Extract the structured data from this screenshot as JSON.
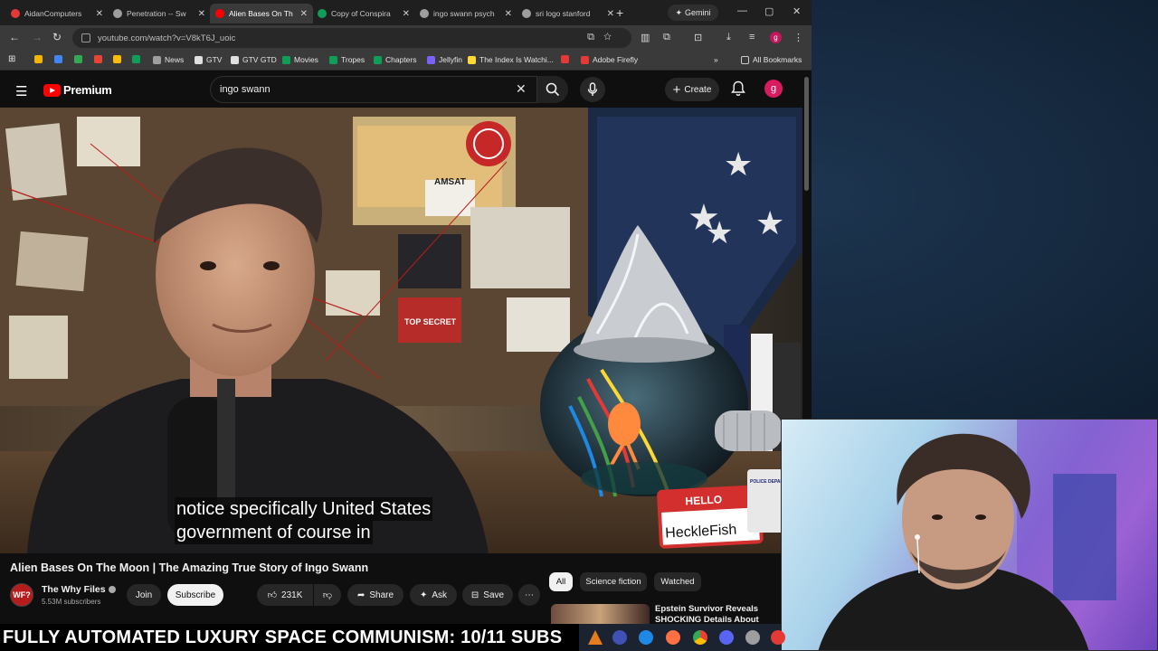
{
  "browser": {
    "tabs": [
      {
        "title": "AidanComputers",
        "favicon_color": "#e53935",
        "active": false
      },
      {
        "title": "Penetration -- Sw",
        "favicon_color": "#9e9e9e",
        "active": false
      },
      {
        "title": "Alien Bases On Th",
        "favicon_color": "#ff0000",
        "active": true
      },
      {
        "title": "Copy of Conspira",
        "favicon_color": "#0f9d58",
        "active": false
      },
      {
        "title": "ingo swann psych",
        "favicon_color": "#9e9e9e",
        "active": false
      },
      {
        "title": "sri logo stanford",
        "favicon_color": "#9e9e9e",
        "active": false
      }
    ],
    "new_tab_label": "+",
    "gemini_label": "Gemini",
    "url": "youtube.com/watch?v=V8kT6J_uoic",
    "profile_initial": "g",
    "bookmarks": [
      {
        "label": "",
        "color": "#f4b400"
      },
      {
        "label": "",
        "color": "#4285f4"
      },
      {
        "label": "",
        "color": "#34a853"
      },
      {
        "label": "",
        "color": "#ea4335"
      },
      {
        "label": "",
        "color": "#fbbc05"
      },
      {
        "label": "",
        "color": "#0f9d58"
      },
      {
        "label": "News",
        "color": "#9e9e9e"
      },
      {
        "label": "GTV",
        "color": "#e0e0e0"
      },
      {
        "label": "GTV GTD",
        "color": "#e0e0e0"
      },
      {
        "label": "Movies",
        "color": "#0f9d58"
      },
      {
        "label": "Tropes",
        "color": "#0f9d58"
      },
      {
        "label": "Chapters",
        "color": "#0f9d58"
      },
      {
        "label": "Jellyfin",
        "color": "#7b61ff"
      },
      {
        "label": "The Index Is Watchi...",
        "color": "#fdd835"
      },
      {
        "label": "",
        "color": "#e53935"
      },
      {
        "label": "Adobe Firefly",
        "color": "#e53935"
      }
    ],
    "all_bookmarks": "All Bookmarks"
  },
  "youtube": {
    "brand": "Premium",
    "search_query": "ingo swann",
    "create_label": "Create",
    "avatar_initial": "g",
    "subtitles": [
      "notice specifically United States",
      "government of course in"
    ],
    "video_title": "Alien Bases On The Moon | The Amazing True Story of Ingo Swann",
    "channel": {
      "name": "The Why Files",
      "subscribers": "5.53M subscribers",
      "avatar_text": "WF?"
    },
    "actions": {
      "join": "Join",
      "subscribe": "Subscribe",
      "likes": "231K",
      "share": "Share",
      "ask": "Ask",
      "save": "Save"
    },
    "chips": [
      "All",
      "Science fiction",
      "Watched"
    ],
    "recommended": {
      "title": "Epstein Survivor Reveals SHOCKING Details About"
    },
    "set_text": {
      "amsat": "AMSAT",
      "hello": "HELLO",
      "my_name_is": "MY NAME IS",
      "name_tag": "HeckleFish",
      "police": "POLICE DEPARTMENT",
      "top_secret": "TOP SECRET"
    }
  },
  "overlay": {
    "ticker": "FULLY AUTOMATED LUXURY SPACE COMMUNISM: 10/11 SUBS"
  },
  "colors": {
    "yt_red": "#ff0000",
    "dark_bg": "#0f0f0f",
    "chrome_bg": "#3a3a3a"
  }
}
